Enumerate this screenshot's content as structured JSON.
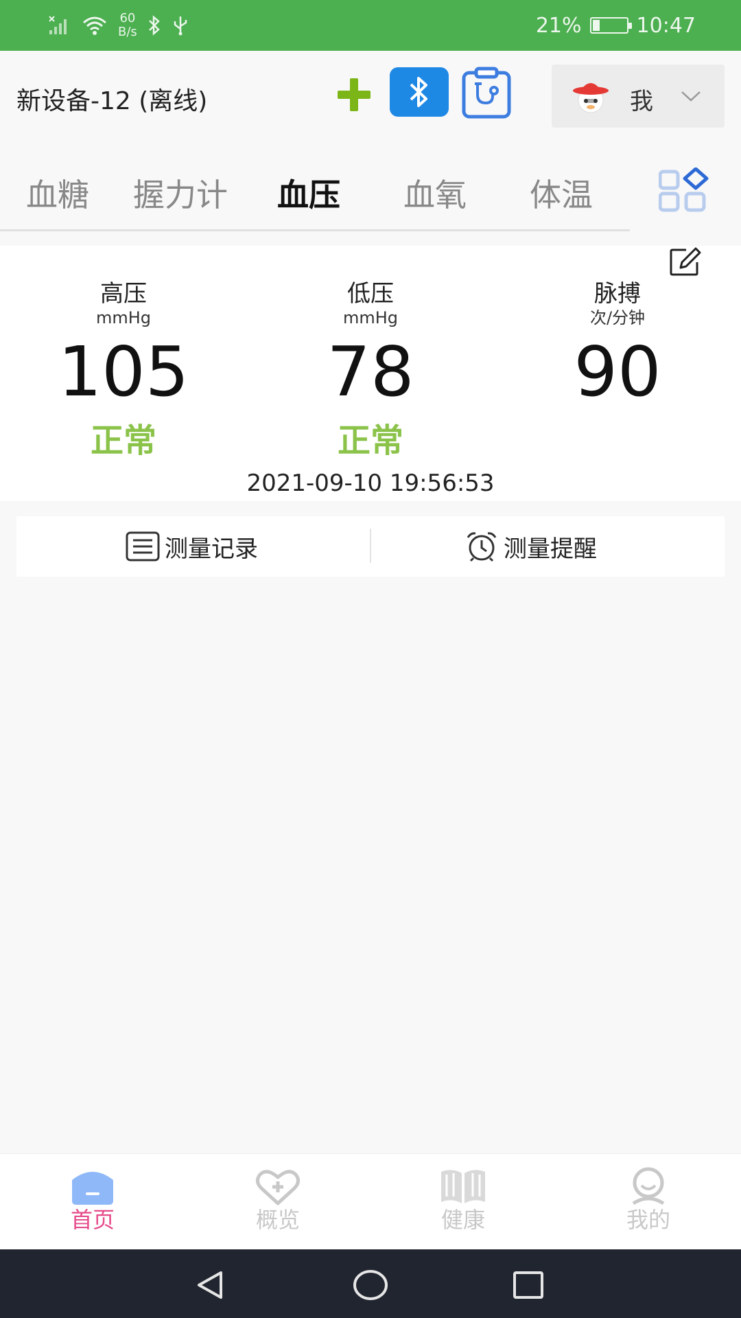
{
  "status_bar": {
    "net_speed_value": "60",
    "net_speed_unit": "B/s",
    "battery": "21%",
    "battery_level": 0.21,
    "time": "10:47"
  },
  "header": {
    "device_title": "新设备-12 (离线)",
    "user_name": "我",
    "colors": {
      "add": "#7cb518",
      "bluetooth": "#1e88e5",
      "clipboard": "#3d7de0"
    }
  },
  "tabs": [
    {
      "label": "血糖",
      "active": false
    },
    {
      "label": "握力计",
      "active": false
    },
    {
      "label": "血压",
      "active": true
    },
    {
      "label": "血氧",
      "active": false
    },
    {
      "label": "体温",
      "active": false
    }
  ],
  "reading": {
    "systolic": {
      "label": "高压",
      "unit": "mmHg",
      "value": "105",
      "status": "正常"
    },
    "diastolic": {
      "label": "低压",
      "unit": "mmHg",
      "value": "78",
      "status": "正常"
    },
    "pulse": {
      "label": "脉搏",
      "unit": "次/分钟",
      "value": "90"
    },
    "timestamp": "2021-09-10 19:56:53",
    "status_color": "#8bc34a"
  },
  "actions": {
    "records_label": "测量记录",
    "reminder_label": "测量提醒"
  },
  "bottom_nav": [
    {
      "label": "首页",
      "icon": "home-icon",
      "active": true
    },
    {
      "label": "概览",
      "icon": "heart-plus-icon",
      "active": false
    },
    {
      "label": "健康",
      "icon": "book-icon",
      "active": false
    },
    {
      "label": "我的",
      "icon": "person-icon",
      "active": false
    }
  ],
  "accent_color": "#e64a8a"
}
